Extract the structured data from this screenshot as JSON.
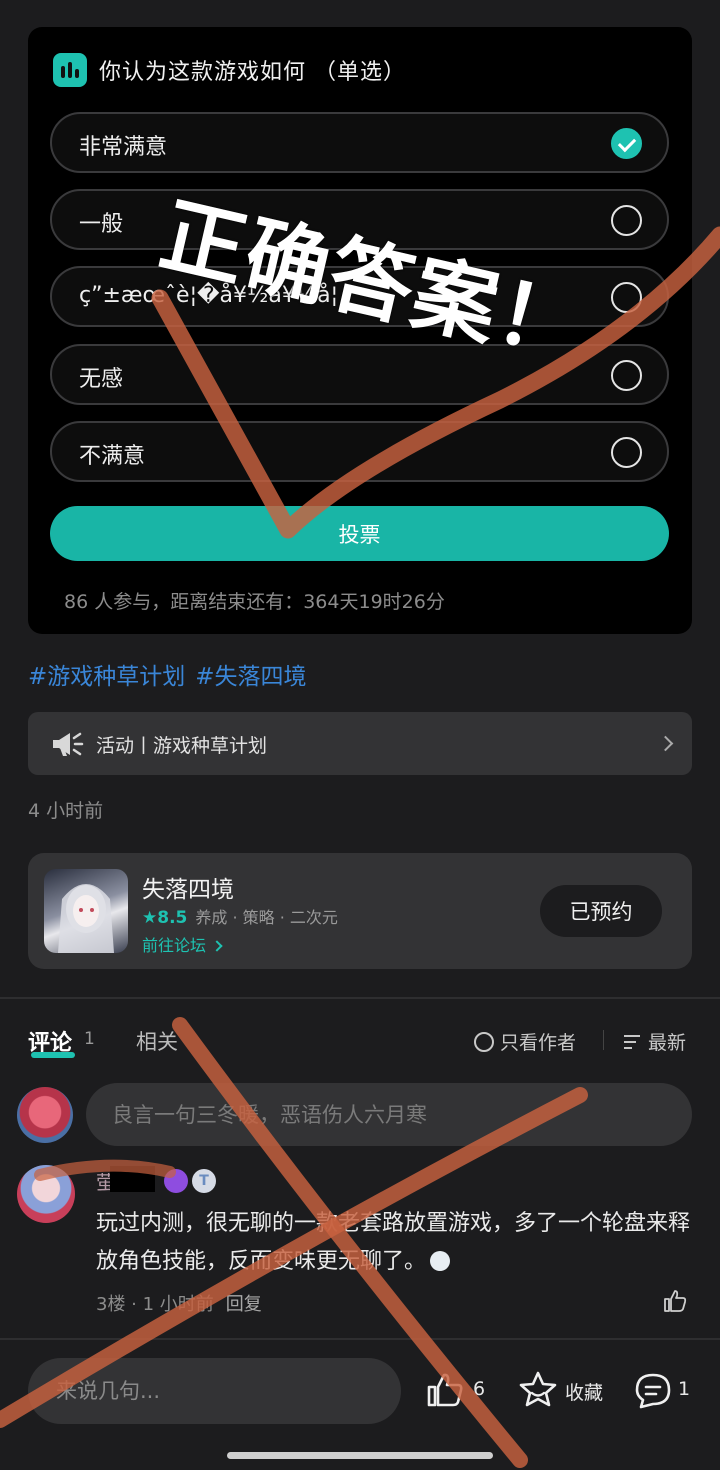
{
  "poll": {
    "title": "你认为这款游戏如何 （单选）",
    "options": [
      {
        "label": "非常满意",
        "selected": true
      },
      {
        "label": "一般",
        "selected": false
      },
      {
        "label": "ç”±æœˆè¦�å¥½å¥½å¦",
        "selected": false
      },
      {
        "label": "无感",
        "selected": false
      },
      {
        "label": "不满意",
        "selected": false
      }
    ],
    "vote_label": "投票",
    "footer": "86 人参与，距离结束还有：364天19时26分"
  },
  "tags": [
    "#游戏种草计划",
    "#失落四境"
  ],
  "activity": {
    "label": "活动丨游戏种草计划"
  },
  "time_ago": "4 小时前",
  "game": {
    "name": "失落四境",
    "score": "★8.5",
    "genres": "养成 · 策略 · 二次元",
    "forum_link": "前往论坛",
    "reserve_label": "已预约"
  },
  "tabs": {
    "comments_label": "评论",
    "comments_count": "1",
    "related_label": "相关",
    "author_only": "只看作者",
    "sort": "最新"
  },
  "comment_input_placeholder": "良言一句三冬暖，恶语伤人六月寒",
  "comment": {
    "author_initial": "萤",
    "badge_t": "T",
    "text": "玩过内测，很无聊的一款老套路放置游戏，多了一个轮盘来释放角色技能，反而变味更无聊了。",
    "meta": "3楼 · 1 小时前",
    "reply": "回复"
  },
  "bottom_bar": {
    "input_placeholder": "来说几句...",
    "like_count": "6",
    "favorite_label": "收藏",
    "comment_count": "1"
  },
  "annotation": {
    "text": "正确答案！",
    "accent": "#c8613f"
  },
  "colors": {
    "accent": "#1ec2b1",
    "tag": "#3a86d8",
    "background": "#1c1c1e"
  }
}
